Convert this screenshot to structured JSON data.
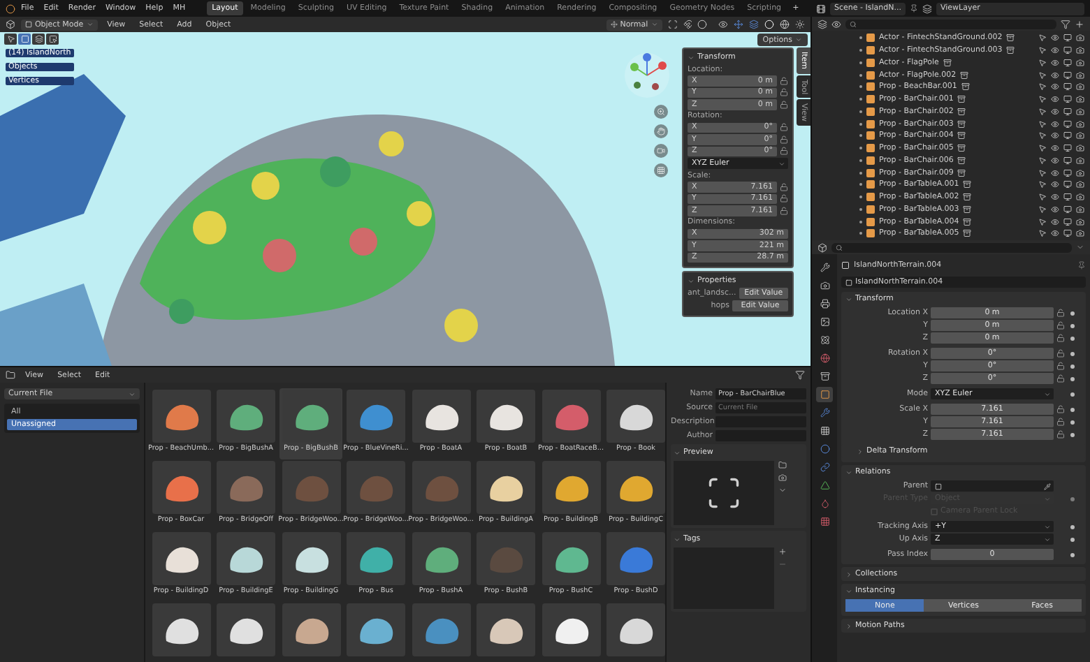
{
  "topbar": {
    "menus": [
      "File",
      "Edit",
      "Render",
      "Window",
      "Help"
    ],
    "app_label": "MH",
    "workspaces": [
      {
        "label": "Layout",
        "selected": true
      },
      {
        "label": "Modeling",
        "selected": false
      },
      {
        "label": "Sculpting",
        "selected": false
      },
      {
        "label": "UV Editing",
        "selected": false
      },
      {
        "label": "Texture Paint",
        "selected": false
      },
      {
        "label": "Shading",
        "selected": false
      },
      {
        "label": "Animation",
        "selected": false
      },
      {
        "label": "Rendering",
        "selected": false
      },
      {
        "label": "Compositing",
        "selected": false
      },
      {
        "label": "Geometry Nodes",
        "selected": false
      },
      {
        "label": "Scripting",
        "selected": false
      }
    ],
    "add_tab": "+",
    "scene": "Scene - IslandN...",
    "view_layer": "ViewLayer"
  },
  "viewport": {
    "mode": "Object Mode",
    "menus": [
      "View",
      "Select",
      "Add",
      "Object"
    ],
    "orientation": "Normal",
    "options": "Options",
    "info": {
      "title": "(14) IslandNorth",
      "stats": [
        "Objects",
        "Vertices"
      ]
    },
    "sidebar_tabs": [
      {
        "label": "Item",
        "selected": true
      },
      {
        "label": "Tool",
        "selected": false
      },
      {
        "label": "View",
        "selected": false
      }
    ],
    "transform": {
      "title": "Transform",
      "expanded": true,
      "groups": [
        {
          "kind": "vector",
          "label": "Location:",
          "rows": [
            {
              "axis": "X",
              "value": "0 m"
            },
            {
              "axis": "Y",
              "value": "0 m"
            },
            {
              "axis": "Z",
              "value": "0 m"
            }
          ]
        },
        {
          "kind": "vector",
          "label": "Rotation:",
          "rows": [
            {
              "axis": "X",
              "value": "0°"
            },
            {
              "axis": "Y",
              "value": "0°"
            },
            {
              "axis": "Z",
              "value": "0°"
            }
          ]
        },
        {
          "kind": "dropdown",
          "value": "XYZ Euler"
        },
        {
          "kind": "vector",
          "label": "Scale:",
          "rows": [
            {
              "axis": "X",
              "value": "7.161"
            },
            {
              "axis": "Y",
              "value": "7.161"
            },
            {
              "axis": "Z",
              "value": "7.161"
            }
          ]
        },
        {
          "kind": "dimensions",
          "label": "Dimensions:",
          "rows": [
            {
              "axis": "X",
              "value": "302 m"
            },
            {
              "axis": "Y",
              "value": "221 m"
            },
            {
              "axis": "Z",
              "value": "28.7 m"
            }
          ]
        }
      ]
    },
    "properties": {
      "title": "Properties",
      "expanded": true,
      "rows": [
        {
          "label": "ant_landsc...",
          "button": "Edit Value"
        },
        {
          "label": "hops",
          "button": "Edit Value"
        }
      ]
    }
  },
  "outliner": {
    "rows": [
      "Actor - FintechStandGround.002",
      "Actor - FintechStandGround.003",
      "Actor - FlagPole",
      "Actor - FlagPole.002",
      "Prop - BeachBar.001",
      "Prop - BarChair.001",
      "Prop - BarChair.002",
      "Prop - BarChair.003",
      "Prop - BarChair.004",
      "Prop - BarChair.005",
      "Prop - BarChair.006",
      "Prop - BarChair.009",
      "Prop - BarTableA.001",
      "Prop - BarTableA.002",
      "Prop - BarTableA.003",
      "Prop - BarTableA.004",
      "Prop - BarTableA.005"
    ]
  },
  "properties_editor": {
    "tabs": [
      {
        "selected": false
      },
      {
        "selected": false
      },
      {
        "selected": false
      },
      {
        "selected": false
      },
      {
        "selected": false
      },
      {
        "selected": false
      },
      {
        "selected": false
      },
      {
        "selected": true
      },
      {
        "selected": false
      },
      {
        "selected": false
      },
      {
        "selected": false
      },
      {
        "selected": false
      },
      {
        "selected": false
      },
      {
        "selected": false
      },
      {
        "selected": false
      }
    ],
    "object_name": "IslandNorthTerrain.004",
    "data_name": "IslandNorthTerrain.004",
    "sections": [
      {
        "title": "Transform",
        "expanded": true,
        "groups": [
          [
            {
              "kind": "vector",
              "label": "Location X",
              "value": "0 m"
            },
            {
              "kind": "vector",
              "label": "Y",
              "value": "0 m"
            },
            {
              "kind": "vector",
              "label": "Z",
              "value": "0 m"
            }
          ],
          [
            {
              "kind": "vector",
              "label": "Rotation X",
              "value": "0°"
            },
            {
              "kind": "vector",
              "label": "Y",
              "value": "0°"
            },
            {
              "kind": "vector",
              "label": "Z",
              "value": "0°"
            }
          ],
          [
            {
              "kind": "dropdown",
              "label": "Mode",
              "value": "XYZ Euler"
            }
          ],
          [
            {
              "kind": "vector",
              "label": "Scale X",
              "value": "7.161"
            },
            {
              "kind": "vector",
              "label": "Y",
              "value": "7.161"
            },
            {
              "kind": "vector",
              "label": "Z",
              "value": "7.161"
            }
          ]
        ],
        "children": [
          {
            "title": "Delta Transform",
            "expanded": false
          }
        ]
      },
      {
        "title": "Relations",
        "expanded": true,
        "groups": [
          [
            {
              "kind": "picker",
              "label": "Parent",
              "disabled": false
            },
            {
              "kind": "dropdown",
              "label": "Parent Type",
              "value": "Object",
              "disabled": true
            },
            {
              "kind": "checkbox",
              "label": "Camera Parent Lock",
              "checked": false,
              "disabled": true
            }
          ],
          [
            {
              "kind": "dropdown",
              "label": "Tracking Axis",
              "value": "+Y",
              "disabled": false
            },
            {
              "kind": "dropdown",
              "label": "Up Axis",
              "value": "Z",
              "disabled": false
            }
          ],
          [
            {
              "kind": "field",
              "label": "Pass Index",
              "value": "0"
            }
          ]
        ]
      },
      {
        "title": "Collections",
        "expanded": false
      },
      {
        "title": "Instancing",
        "expanded": true,
        "groups": [
          [
            {
              "kind": "segmented",
              "options": [
                {
                  "label": "None",
                  "selected": true
                },
                {
                  "label": "Vertices",
                  "selected": false
                },
                {
                  "label": "Faces",
                  "selected": false
                }
              ]
            }
          ]
        ]
      },
      {
        "title": "Motion Paths",
        "expanded": false
      }
    ]
  },
  "asset_browser": {
    "menus": [
      "View",
      "Select",
      "Edit"
    ],
    "library": "Current File",
    "catalogs": [
      {
        "label": "All",
        "selected": false
      },
      {
        "label": "Unassigned",
        "selected": true
      }
    ],
    "assets": [
      {
        "label": "Prop - BeachUmb...",
        "color": "#e07a4a",
        "selected": false
      },
      {
        "label": "Prop - BigBushA",
        "color": "#5fae7c",
        "selected": false
      },
      {
        "label": "Prop - BigBushB",
        "color": "#5fae7c",
        "selected": true
      },
      {
        "label": "Prop - BlueVineRi...",
        "color": "#3f8fd0",
        "selected": false
      },
      {
        "label": "Prop - BoatA",
        "color": "#e8e4e0",
        "selected": false
      },
      {
        "label": "Prop - BoatB",
        "color": "#e8e4e0",
        "selected": false
      },
      {
        "label": "Prop - BoatRaceB...",
        "color": "#d45d6a",
        "selected": false
      },
      {
        "label": "Prop - Book",
        "color": "#d8d8d8",
        "selected": false
      },
      {
        "label": "Prop - BoxCar",
        "color": "#e8704a",
        "selected": false
      },
      {
        "label": "Prop - BridgeOff",
        "color": "#8a6a5a",
        "selected": false
      },
      {
        "label": "Prop - BridgeWoo...",
        "color": "#6e5040",
        "selected": false
      },
      {
        "label": "Prop - BridgeWoo...",
        "color": "#6e5040",
        "selected": false
      },
      {
        "label": "Prop - BridgeWoo...",
        "color": "#6e5040",
        "selected": false
      },
      {
        "label": "Prop - BuildingA",
        "color": "#e8d0a0",
        "selected": false
      },
      {
        "label": "Prop - BuildingB",
        "color": "#e0a830",
        "selected": false
      },
      {
        "label": "Prop - BuildingC",
        "color": "#e0a830",
        "selected": false
      },
      {
        "label": "Prop - BuildingD",
        "color": "#e8e0d8",
        "selected": false
      },
      {
        "label": "Prop - BuildingE",
        "color": "#b8d8d8",
        "selected": false
      },
      {
        "label": "Prop - BuildingG",
        "color": "#c8e0e0",
        "selected": false
      },
      {
        "label": "Prop - Bus",
        "color": "#40b0a8",
        "selected": false
      },
      {
        "label": "Prop - BushA",
        "color": "#5fae7c",
        "selected": false
      },
      {
        "label": "Prop - BushB",
        "color": "#5a4a40",
        "selected": false
      },
      {
        "label": "Prop - BushC",
        "color": "#5fb890",
        "selected": false
      },
      {
        "label": "Prop - BushD",
        "color": "#3a7ad8",
        "selected": false
      },
      {
        "color": "#e0e0e0",
        "selected": false
      },
      {
        "color": "#e0e0e0",
        "selected": false
      },
      {
        "color": "#c8a890",
        "selected": false
      },
      {
        "color": "#6ab0d0",
        "selected": false
      },
      {
        "color": "#4a90c0",
        "selected": false
      },
      {
        "color": "#d8c8b8",
        "selected": false
      },
      {
        "color": "#f0f0f0",
        "selected": false
      },
      {
        "color": "#d8d8d8",
        "selected": false
      }
    ],
    "details": {
      "name_label": "Name",
      "name": "Prop - BarChairBlue",
      "source_label": "Source",
      "source": "Current File",
      "description_label": "Description",
      "author_label": "Author",
      "preview_title": "Preview",
      "tags_title": "Tags"
    }
  }
}
